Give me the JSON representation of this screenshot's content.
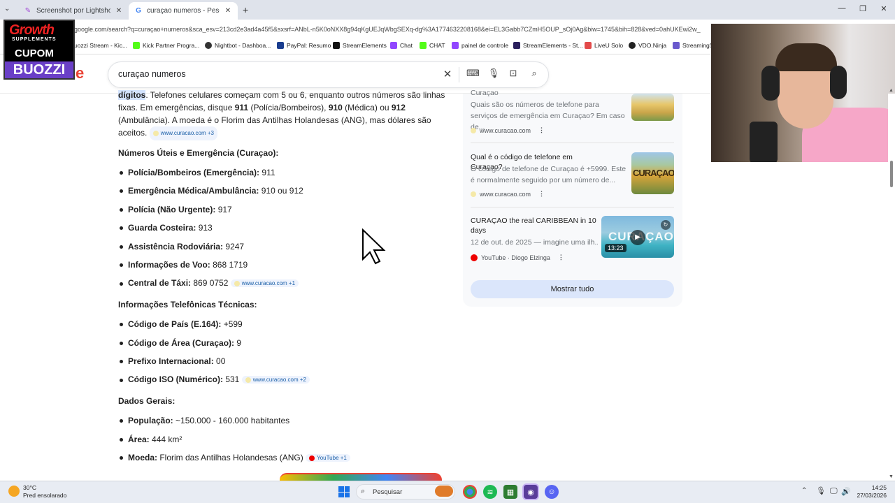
{
  "browser": {
    "tabs": [
      {
        "title": "Screenshot por Lightshot",
        "active": false
      },
      {
        "title": "curaçao numeros - Pesquisa Go",
        "active": true
      }
    ],
    "url": "google.com/search?q=curaçao+numeros&sca_esv=213cd2e3ad4a45f5&sxsrf=ANbL-n5K0oNXX8g94qKgUEJqWbgSEXq-dg%3A1774632208168&ei=EL3Gabb7CZmH5OUP_sOj0Ag&biw=1745&bih=828&ved=0ahUKEwi2w_",
    "bookmarks": [
      "uozzi Stream - Kic...",
      "Kick Partner Progra...",
      "Nightbot - Dashboa...",
      "PayPal: Resumo",
      "StreamElements",
      "Chat",
      "CHAT",
      "painel de controle",
      "StreamElements - St...",
      "LiveU Solo",
      "VDO.Ninja",
      "StreamingS"
    ]
  },
  "overlay_logo": {
    "line1": "Growth",
    "line2": "SUPPLEMENTS",
    "line3": "CUPOM",
    "line4": "BUOZZI"
  },
  "search": {
    "query": "curaçao numeros",
    "logo_fragment": "e"
  },
  "ai_overview": {
    "intro_bold": "dígitos",
    "intro_rest": ". Telefones celulares começam com 5 ou 6, enquanto outros números são linhas",
    "line2a": "fixas. Em emergências, disque ",
    "n911": "911",
    "line2b": " (Polícia/Bombeiros), ",
    "n910": "910",
    "line2c": " (Médica) ou ",
    "n912": "912",
    "line3": "(Ambulância). A moeda é o Florim das Antilhas Holandesas (ANG), mas dólares são",
    "line4": "aceitos.",
    "chip1": "www.curacao.com +3",
    "section1": "Números Úteis e Emergência (Curaçao):",
    "items1": [
      {
        "label": "Polícia/Bombeiros (Emergência):",
        "value": " 911"
      },
      {
        "label": "Emergência Médica/Ambulância:",
        "value": " 910 ou 912"
      },
      {
        "label": "Polícia (Não Urgente):",
        "value": " 917"
      },
      {
        "label": "Guarda Costeira:",
        "value": " 913"
      },
      {
        "label": "Assistência Rodoviária:",
        "value": " 9247"
      },
      {
        "label": "Informações de Voo:",
        "value": " 868 1719"
      },
      {
        "label": "Central de Táxi:",
        "value": " 869 0752"
      }
    ],
    "chip2": "www.curacao.com +1",
    "section2": "Informações Telefônicas Técnicas:",
    "items2": [
      {
        "label": "Código de País (E.164):",
        "value": " +599"
      },
      {
        "label": "Código de Área (Curaçao):",
        "value": " 9"
      },
      {
        "label": "Prefixo Internacional:",
        "value": " 00"
      },
      {
        "label": "Código ISO (Numérico):",
        "value": " 531"
      }
    ],
    "chip3": "www.curacao.com +2",
    "section3": "Dados Gerais:",
    "items3": [
      {
        "label": "População:",
        "value": " ~150.000 - 160.000 habitantes"
      },
      {
        "label": "Área:",
        "value": " 444 km²"
      },
      {
        "label": "Moeda:",
        "value": " Florim das Antilhas Holandesas (ANG)"
      }
    ],
    "chip4": "YouTube +1"
  },
  "side_panel": {
    "cards": [
      {
        "title": "Curaçao",
        "snippet": "Quais são os números de telefone para serviços de emergência em Curaçao? Em caso de...",
        "source": "www.curacao.com"
      },
      {
        "title": "Qual é o código de telefone em Curaçao?",
        "snippet": "O código de telefone de Curaçao é +5999. Este é normalmente seguido por um número de...",
        "source": "www.curacao.com"
      },
      {
        "title": "CURAÇAO the real CARIBBEAN in 10 days",
        "snippet": "12 de out. de 2025 — imagine uma ilh...",
        "source": "YouTube · Diogo Elzinga",
        "duration": "13:23",
        "thumb_text": "CURAÇAO"
      }
    ],
    "show_all": "Mostrar tudo"
  },
  "taskbar": {
    "weather_temp": "30°C",
    "weather_desc": "Pred ensolarado",
    "search_label": "Pesquisar",
    "time": "14:25",
    "date": "27/03/2026"
  }
}
